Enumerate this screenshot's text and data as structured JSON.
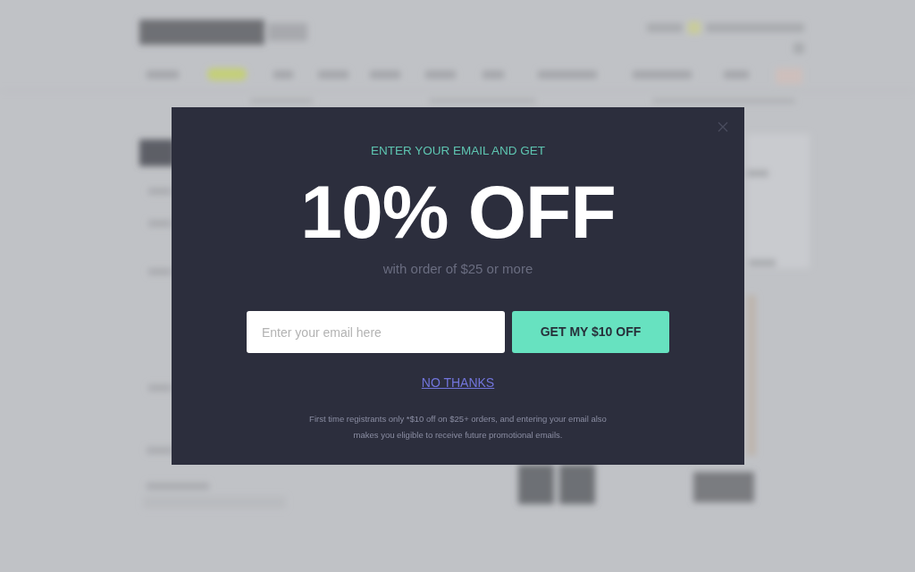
{
  "popup": {
    "eyebrow": "ENTER YOUR EMAIL AND GET",
    "headline": "10% OFF",
    "subheadline": "with order of $25 or more",
    "email_field": {
      "placeholder": "Enter your email here"
    },
    "submit_button": "GET MY $10 OFF",
    "decline_link": "NO THANKS",
    "disclaimer": "First time registrants only *$10 off on $25+ orders, and entering your email also makes you eligible to receive future promotional emails."
  }
}
